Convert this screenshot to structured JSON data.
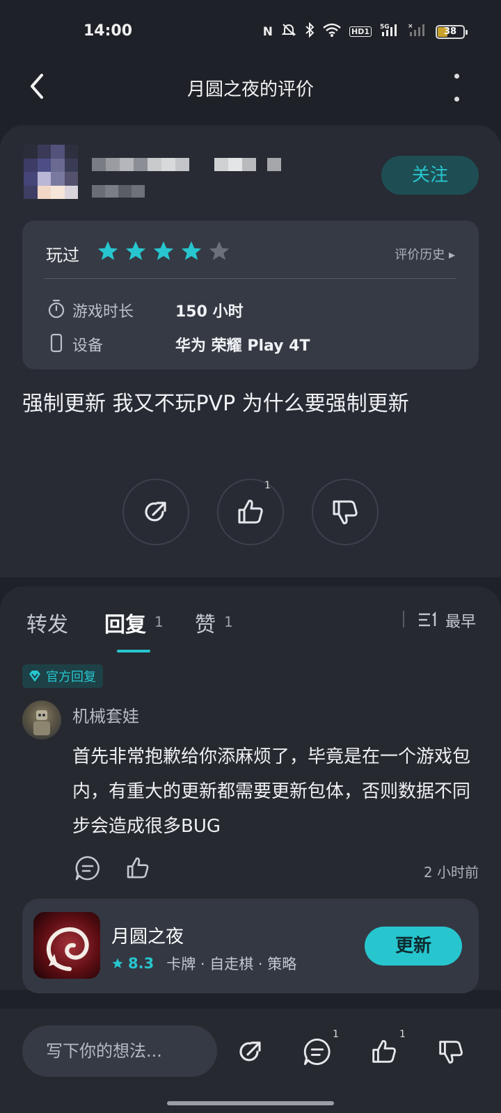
{
  "status_bar": {
    "time": "14:00",
    "battery": "38",
    "network": "5G",
    "hd_label": "HD1"
  },
  "header": {
    "title": "月圆之夜的评价"
  },
  "review": {
    "follow_label": "关注",
    "played_label": "玩过",
    "rating": 4,
    "rating_max": 5,
    "history_label": "评价历史 ▸",
    "playtime_label": "游戏时长",
    "playtime_value": "150 小时",
    "device_label": "设备",
    "device_value": "华为 荣耀 Play 4T",
    "text": "强制更新 我又不玩PVP 为什么要强制更新",
    "like_count": "1"
  },
  "tabs": [
    {
      "label": "转发",
      "count": ""
    },
    {
      "label": "回复",
      "count": "1"
    },
    {
      "label": "赞",
      "count": "1"
    }
  ],
  "sort": {
    "label": "最早"
  },
  "reply": {
    "badge": "官方回复",
    "author": "机械套娃",
    "text": "首先非常抱歉给你添麻烦了，毕竟是在一个游戏包内，有重大的更新都需要更新包体，否则数据不同步会造成很多BUG",
    "time": "2 小时前"
  },
  "app": {
    "name": "月圆之夜",
    "rating": "8.3",
    "tags": "卡牌 · 自走棋 · 策略",
    "button_label": "更新"
  },
  "bottom_bar": {
    "input_placeholder": "写下你的想法...",
    "comment_count": "1",
    "like_count": "1"
  },
  "colors": {
    "accent": "#27c6cf",
    "background": "#1f2128",
    "card": "#282b33"
  }
}
